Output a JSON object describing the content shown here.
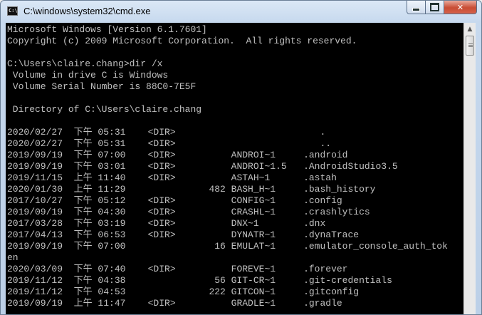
{
  "window": {
    "title": "C:\\windows\\system32\\cmd.exe",
    "icon_label": "C:\\",
    "minimize_icon": "minimize-icon",
    "maximize_icon": "maximize-icon",
    "close_label": "✕"
  },
  "console": {
    "background": "#000000",
    "foreground": "#c0c0c0",
    "lines": [
      "Microsoft Windows [Version 6.1.7601]",
      "Copyright (c) 2009 Microsoft Corporation.  All rights reserved.",
      "",
      "C:\\Users\\claire.chang>dir /x",
      " Volume in drive C is Windows",
      " Volume Serial Number is 88C0-7E5F",
      "",
      " Directory of C:\\Users\\claire.chang",
      "",
      "2020/02/27  下午 05:31    <DIR>                          .",
      "2020/02/27  下午 05:31    <DIR>                          ..",
      "2019/09/19  下午 07:00    <DIR>          ANDROI~1     .android",
      "2019/09/19  下午 03:01    <DIR>          ANDROI~1.5   .AndroidStudio3.5",
      "2019/11/15  上午 11:40    <DIR>          ASTAH~1      .astah",
      "2020/01/30  上午 11:29               482 BASH_H~1     .bash_history",
      "2017/10/27  下午 05:12    <DIR>          CONFIG~1     .config",
      "2019/09/19  下午 04:30    <DIR>          CRASHL~1     .crashlytics",
      "2017/03/28  下午 03:19    <DIR>          DNX~1        .dnx",
      "2017/04/13  下午 06:53    <DIR>          DYNATR~1     .dynaTrace",
      "2019/09/19  下午 07:00                16 EMULAT~1     .emulator_console_auth_tok",
      "en",
      "2020/03/09  下午 07:40    <DIR>          FOREVE~1     .forever",
      "2019/11/12  下午 04:38                56 GIT-CR~1     .git-credentials",
      "2019/11/12  下午 04:53               222 GITCON~1     .gitconfig",
      "2019/09/19  上午 11:47    <DIR>          GRADLE~1     .gradle"
    ]
  },
  "scrollbar": {
    "up_arrow": "▲"
  }
}
